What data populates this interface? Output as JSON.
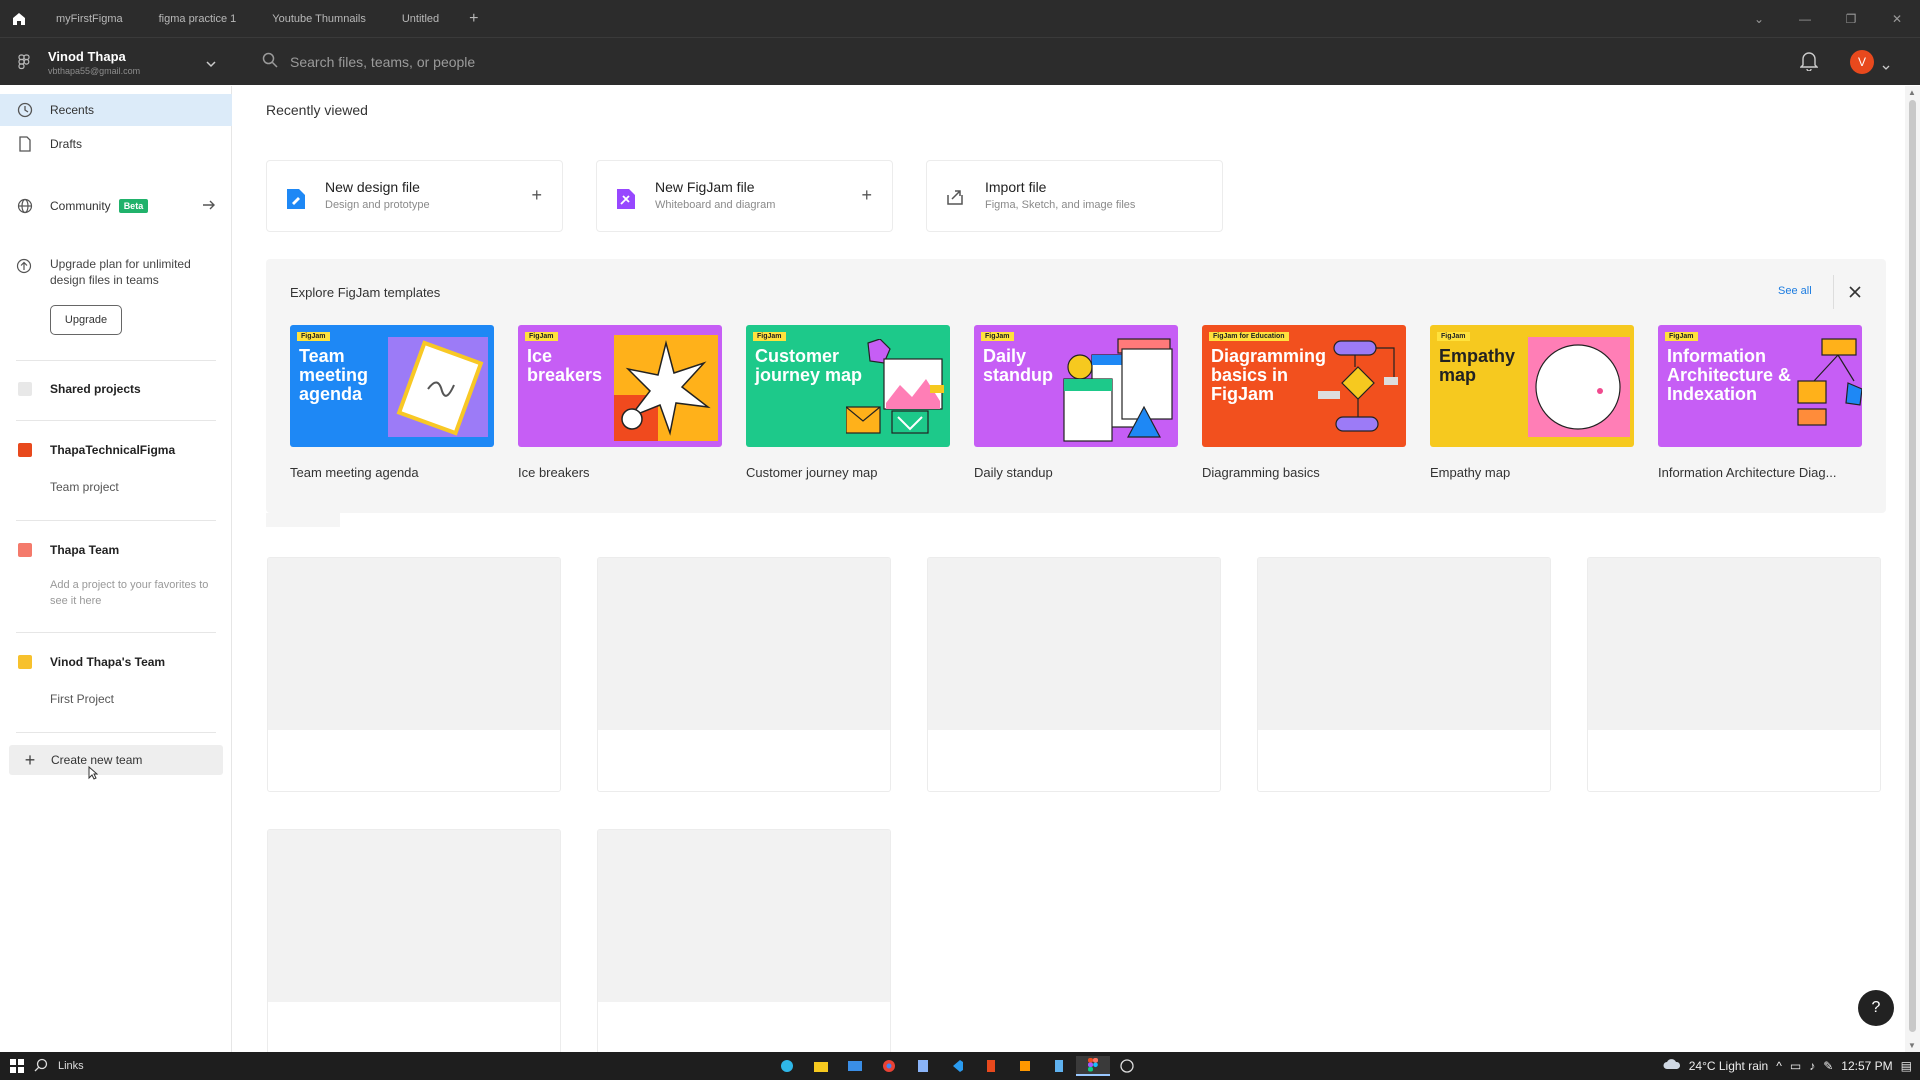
{
  "titlebar": {
    "tabs": [
      "myFirstFigma",
      "figma practice 1",
      "Youtube Thumnails",
      "Untitled"
    ],
    "add_tab": "+",
    "controls": [
      "⌄",
      "—",
      "❐",
      "✕"
    ]
  },
  "header": {
    "user_name": "Vinod Thapa",
    "user_email": "vbthapa55@gmail.com",
    "search_placeholder": "Search files, teams, or people",
    "avatar_letter": "V",
    "accent_color": "#e8491d"
  },
  "sidebar": {
    "recents": "Recents",
    "drafts": "Drafts",
    "community": "Community",
    "community_badge": "Beta",
    "upgrade_text": "Upgrade plan for unlimited design files in teams",
    "upgrade_button": "Upgrade",
    "shared_projects": "Shared projects",
    "teams": [
      {
        "name": "ThapaTechnicalFigma",
        "color": "#e8491d",
        "sub": "Team project"
      },
      {
        "name": "Thapa Team",
        "color": "#f47a6b",
        "sub": "Add a project to your favorites to see it here"
      },
      {
        "name": "Vinod Thapa's Team",
        "color": "#f7c12d",
        "sub": "First Project"
      }
    ],
    "create_team": "Create new team"
  },
  "main": {
    "title": "Recently viewed",
    "cards": [
      {
        "title": "New design file",
        "sub": "Design and prototype",
        "plus": "+"
      },
      {
        "title": "New FigJam file",
        "sub": "Whiteboard and diagram",
        "plus": "+"
      },
      {
        "title": "Import file",
        "sub": "Figma, Sketch, and image files"
      }
    ],
    "templates": {
      "heading": "Explore FigJam templates",
      "see_all": "See all",
      "items": [
        {
          "label": "Team meeting agenda",
          "thumb_text": "Team meeting agenda",
          "tag": "FigJam",
          "bg": "#1e88f5"
        },
        {
          "label": "Ice breakers",
          "thumb_text": "Ice breakers",
          "tag": "FigJam",
          "bg": "#c65ef5"
        },
        {
          "label": "Customer journey map",
          "thumb_text": "Customer journey map",
          "tag": "FigJam",
          "bg": "#1dc98a"
        },
        {
          "label": "Daily standup",
          "thumb_text": "Daily standup",
          "tag": "FigJam",
          "bg": "#c65ef5"
        },
        {
          "label": "Diagramming basics",
          "thumb_text": "Diagramming basics in FigJam",
          "tag": "FigJam for Education",
          "bg": "#f2501e"
        },
        {
          "label": "Empathy map",
          "thumb_text": "Empathy map",
          "tag": "FigJam",
          "bg": "#f6c91f"
        },
        {
          "label": "Information Architecture Diag...",
          "thumb_text": "Information Architecture & Indexation",
          "tag": "FigJam",
          "bg": "#c65ef5"
        }
      ]
    }
  },
  "help": "?",
  "taskbar": {
    "search_label": "Links",
    "weather": "24°C  Light rain",
    "time": "12:57 PM"
  }
}
